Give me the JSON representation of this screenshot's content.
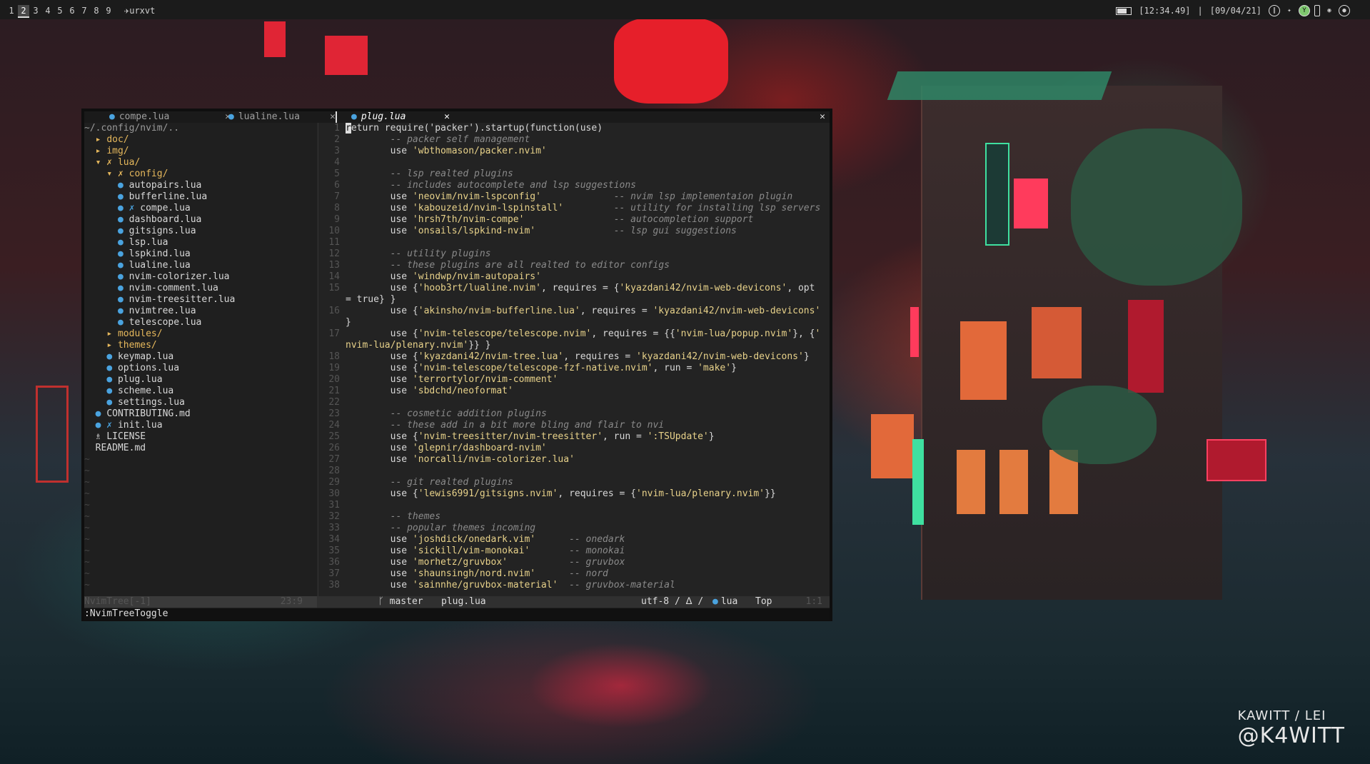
{
  "topbar": {
    "workspaces": [
      "1",
      "2",
      "3",
      "4",
      "5",
      "6",
      "7",
      "8",
      "9"
    ],
    "active_workspace": "2",
    "window_title": "urxvt",
    "window_icon": "plane-icon",
    "clock": "[12:34.49]",
    "separator": "|",
    "date": "[09/04/21]"
  },
  "tabs": [
    {
      "label": "compe.lua",
      "close": "✕",
      "active": false
    },
    {
      "label": "lualine.lua",
      "close": "✕",
      "active": false
    },
    {
      "label": "plug.lua",
      "close": "✕",
      "active": true
    }
  ],
  "tab_close_all": "✕",
  "tree": {
    "root": "~/.config/nvim/..",
    "rows": [
      {
        "indent": "",
        "icon": "▸ ",
        "name": "doc/",
        "type": "dir"
      },
      {
        "indent": "",
        "icon": "▸ ",
        "name": "img/",
        "type": "dir"
      },
      {
        "indent": "",
        "icon": "▾ ✗ ",
        "name": "lua/",
        "type": "dir"
      },
      {
        "indent": "  ",
        "icon": "▾ ✗ ",
        "name": "config/",
        "type": "dir"
      },
      {
        "indent": "    ",
        "icon": "● ",
        "name": "autopairs.lua",
        "type": "file"
      },
      {
        "indent": "    ",
        "icon": "● ",
        "name": "bufferline.lua",
        "type": "file"
      },
      {
        "indent": "    ",
        "icon": "● ✗ ",
        "name": "compe.lua",
        "type": "file-mod"
      },
      {
        "indent": "    ",
        "icon": "● ",
        "name": "dashboard.lua",
        "type": "file"
      },
      {
        "indent": "    ",
        "icon": "● ",
        "name": "gitsigns.lua",
        "type": "file"
      },
      {
        "indent": "    ",
        "icon": "● ",
        "name": "lsp.lua",
        "type": "file"
      },
      {
        "indent": "    ",
        "icon": "● ",
        "name": "lspkind.lua",
        "type": "file"
      },
      {
        "indent": "    ",
        "icon": "● ",
        "name": "lualine.lua",
        "type": "file"
      },
      {
        "indent": "    ",
        "icon": "● ",
        "name": "nvim-colorizer.lua",
        "type": "file"
      },
      {
        "indent": "    ",
        "icon": "● ",
        "name": "nvim-comment.lua",
        "type": "file"
      },
      {
        "indent": "    ",
        "icon": "● ",
        "name": "nvim-treesitter.lua",
        "type": "file"
      },
      {
        "indent": "    ",
        "icon": "● ",
        "name": "nvimtree.lua",
        "type": "file"
      },
      {
        "indent": "    ",
        "icon": "● ",
        "name": "telescope.lua",
        "type": "file"
      },
      {
        "indent": "  ",
        "icon": "▸ ",
        "name": "modules/",
        "type": "dir"
      },
      {
        "indent": "  ",
        "icon": "▸ ",
        "name": "themes/",
        "type": "dir"
      },
      {
        "indent": "  ",
        "icon": "● ",
        "name": "keymap.lua",
        "type": "file"
      },
      {
        "indent": "  ",
        "icon": "● ",
        "name": "options.lua",
        "type": "file"
      },
      {
        "indent": "  ",
        "icon": "● ",
        "name": "plug.lua",
        "type": "file"
      },
      {
        "indent": "  ",
        "icon": "● ",
        "name": "scheme.lua",
        "type": "file"
      },
      {
        "indent": "  ",
        "icon": "● ",
        "name": "settings.lua",
        "type": "file"
      },
      {
        "indent": "",
        "icon": "● ",
        "name": "CONTRIBUTING.md",
        "type": "file"
      },
      {
        "indent": "",
        "icon": "● ✗ ",
        "name": "init.lua",
        "type": "file-mod"
      },
      {
        "indent": "",
        "icon": "♗ ",
        "name": "LICENSE",
        "type": "file"
      },
      {
        "indent": "",
        "icon": "",
        "name": "README.md",
        "type": "file"
      }
    ],
    "tildes": 12
  },
  "editor": {
    "lines": [
      {
        "n": "1",
        "segs": [
          [
            "code",
            "return require('packer').startup(function(use)"
          ]
        ]
      },
      {
        "n": "2",
        "segs": [
          [
            "code",
            "        "
          ],
          [
            "cmt",
            "-- packer self management"
          ]
        ]
      },
      {
        "n": "3",
        "segs": [
          [
            "code",
            "        use "
          ],
          [
            "str",
            "'wbthomason/packer.nvim'"
          ]
        ]
      },
      {
        "n": "4",
        "segs": []
      },
      {
        "n": "5",
        "segs": [
          [
            "code",
            "        "
          ],
          [
            "cmt",
            "-- lsp realted plugins"
          ]
        ]
      },
      {
        "n": "6",
        "segs": [
          [
            "code",
            "        "
          ],
          [
            "cmt",
            "-- includes autocomplete and lsp suggestions"
          ]
        ]
      },
      {
        "n": "7",
        "segs": [
          [
            "code",
            "        use "
          ],
          [
            "str",
            "'neovim/nvim-lspconfig'"
          ],
          [
            "code",
            "             "
          ],
          [
            "cmt",
            "-- nvim lsp implementaion plugin"
          ]
        ]
      },
      {
        "n": "8",
        "segs": [
          [
            "code",
            "        use "
          ],
          [
            "str",
            "'kabouzeid/nvim-lspinstall'"
          ],
          [
            "code",
            "         "
          ],
          [
            "cmt",
            "-- utility for installing lsp servers"
          ]
        ]
      },
      {
        "n": "9",
        "segs": [
          [
            "code",
            "        use "
          ],
          [
            "str",
            "'hrsh7th/nvim-compe'"
          ],
          [
            "code",
            "                "
          ],
          [
            "cmt",
            "-- autocompletion support"
          ]
        ]
      },
      {
        "n": "10",
        "segs": [
          [
            "code",
            "        use "
          ],
          [
            "str",
            "'onsails/lspkind-nvim'"
          ],
          [
            "code",
            "              "
          ],
          [
            "cmt",
            "-- lsp gui suggestions"
          ]
        ]
      },
      {
        "n": "11",
        "segs": []
      },
      {
        "n": "12",
        "segs": [
          [
            "code",
            "        "
          ],
          [
            "cmt",
            "-- utility plugins"
          ]
        ]
      },
      {
        "n": "13",
        "segs": [
          [
            "code",
            "        "
          ],
          [
            "cmt",
            "-- these plugins are all realted to editor configs"
          ]
        ]
      },
      {
        "n": "14",
        "segs": [
          [
            "code",
            "        use "
          ],
          [
            "str",
            "'windwp/nvim-autopairs'"
          ]
        ]
      },
      {
        "n": "15",
        "segs": [
          [
            "code",
            "        use {"
          ],
          [
            "str",
            "'hoob3rt/lualine.nvim'"
          ],
          [
            "code",
            ", requires = {"
          ],
          [
            "str",
            "'kyazdani42/nvim-web-devicons'"
          ],
          [
            "code",
            ", opt"
          ]
        ]
      },
      {
        "n": "",
        "segs": [
          [
            "code",
            "= true} }"
          ]
        ]
      },
      {
        "n": "16",
        "segs": [
          [
            "code",
            "        use {"
          ],
          [
            "str",
            "'akinsho/nvim-bufferline.lua'"
          ],
          [
            "code",
            ", requires = "
          ],
          [
            "str",
            "'kyazdani42/nvim-web-devicons'"
          ]
        ]
      },
      {
        "n": "",
        "segs": [
          [
            "code",
            "}"
          ]
        ]
      },
      {
        "n": "17",
        "segs": [
          [
            "code",
            "        use {"
          ],
          [
            "str",
            "'nvim-telescope/telescope.nvim'"
          ],
          [
            "code",
            ", requires = {{"
          ],
          [
            "str",
            "'nvim-lua/popup.nvim'"
          ],
          [
            "code",
            "}, {"
          ],
          [
            "str",
            "'"
          ]
        ]
      },
      {
        "n": "",
        "segs": [
          [
            "str",
            "nvim-lua/plenary.nvim'"
          ],
          [
            "code",
            "}} }"
          ]
        ]
      },
      {
        "n": "18",
        "segs": [
          [
            "code",
            "        use {"
          ],
          [
            "str",
            "'kyazdani42/nvim-tree.lua'"
          ],
          [
            "code",
            ", requires = "
          ],
          [
            "str",
            "'kyazdani42/nvim-web-devicons'"
          ],
          [
            "code",
            "}"
          ]
        ]
      },
      {
        "n": "19",
        "segs": [
          [
            "code",
            "        use {"
          ],
          [
            "str",
            "'nvim-telescope/telescope-fzf-native.nvim'"
          ],
          [
            "code",
            ", run = "
          ],
          [
            "str",
            "'make'"
          ],
          [
            "code",
            "}"
          ]
        ]
      },
      {
        "n": "20",
        "segs": [
          [
            "code",
            "        use "
          ],
          [
            "str",
            "'terrortylor/nvim-comment'"
          ]
        ]
      },
      {
        "n": "21",
        "segs": [
          [
            "code",
            "        use "
          ],
          [
            "str",
            "'sbdchd/neoformat'"
          ]
        ]
      },
      {
        "n": "22",
        "segs": []
      },
      {
        "n": "23",
        "segs": [
          [
            "code",
            "        "
          ],
          [
            "cmt",
            "-- cosmetic addition plugins"
          ]
        ]
      },
      {
        "n": "24",
        "segs": [
          [
            "code",
            "        "
          ],
          [
            "cmt",
            "-- these add in a bit more bling and flair to nvi"
          ]
        ]
      },
      {
        "n": "25",
        "segs": [
          [
            "code",
            "        use {"
          ],
          [
            "str",
            "'nvim-treesitter/nvim-treesitter'"
          ],
          [
            "code",
            ", run = "
          ],
          [
            "str",
            "':TSUpdate'"
          ],
          [
            "code",
            "}"
          ]
        ]
      },
      {
        "n": "26",
        "segs": [
          [
            "code",
            "        use "
          ],
          [
            "str",
            "'glepnir/dashboard-nvim'"
          ]
        ]
      },
      {
        "n": "27",
        "segs": [
          [
            "code",
            "        use "
          ],
          [
            "str",
            "'norcalli/nvim-colorizer.lua'"
          ]
        ]
      },
      {
        "n": "28",
        "segs": []
      },
      {
        "n": "29",
        "segs": [
          [
            "code",
            "        "
          ],
          [
            "cmt",
            "-- git realted plugins"
          ]
        ]
      },
      {
        "n": "30",
        "segs": [
          [
            "code",
            "        use {"
          ],
          [
            "str",
            "'lewis6991/gitsigns.nvim'"
          ],
          [
            "code",
            ", requires = {"
          ],
          [
            "str",
            "'nvim-lua/plenary.nvim'"
          ],
          [
            "code",
            "}}"
          ]
        ]
      },
      {
        "n": "31",
        "segs": []
      },
      {
        "n": "32",
        "segs": [
          [
            "code",
            "        "
          ],
          [
            "cmt",
            "-- themes"
          ]
        ]
      },
      {
        "n": "33",
        "segs": [
          [
            "code",
            "        "
          ],
          [
            "cmt",
            "-- popular themes incoming"
          ]
        ]
      },
      {
        "n": "34",
        "segs": [
          [
            "code",
            "        use "
          ],
          [
            "str",
            "'joshdick/onedark.vim'"
          ],
          [
            "code",
            "      "
          ],
          [
            "cmt",
            "-- onedark"
          ]
        ]
      },
      {
        "n": "35",
        "segs": [
          [
            "code",
            "        use "
          ],
          [
            "str",
            "'sickill/vim-monokai'"
          ],
          [
            "code",
            "       "
          ],
          [
            "cmt",
            "-- monokai"
          ]
        ]
      },
      {
        "n": "36",
        "segs": [
          [
            "code",
            "        use "
          ],
          [
            "str",
            "'morhetz/gruvbox'"
          ],
          [
            "code",
            "           "
          ],
          [
            "cmt",
            "-- gruvbox"
          ]
        ]
      },
      {
        "n": "37",
        "segs": [
          [
            "code",
            "        use "
          ],
          [
            "str",
            "'shaunsingh/nord.nvim'"
          ],
          [
            "code",
            "      "
          ],
          [
            "cmt",
            "-- nord"
          ]
        ]
      },
      {
        "n": "38",
        "segs": [
          [
            "code",
            "        use "
          ],
          [
            "str",
            "'sainnhe/gruvbox-material'"
          ],
          [
            "code",
            "  "
          ],
          [
            "cmt",
            "-- gruvbox-material"
          ]
        ]
      }
    ]
  },
  "statusbar": {
    "tree_title": "NvimTree[-1]",
    "tree_pos": "23:9",
    "branch_icon": "ᚴ",
    "branch": "master",
    "filename": "plug.lua",
    "encoding": "utf-8 / ᐃ /",
    "filetype": "lua",
    "position": "Top",
    "cursor": "1:1"
  },
  "cmdline": ":NvimTreeToggle",
  "watermark": {
    "line1": "KAWITT / LEI",
    "line2": "@K4WITT"
  }
}
